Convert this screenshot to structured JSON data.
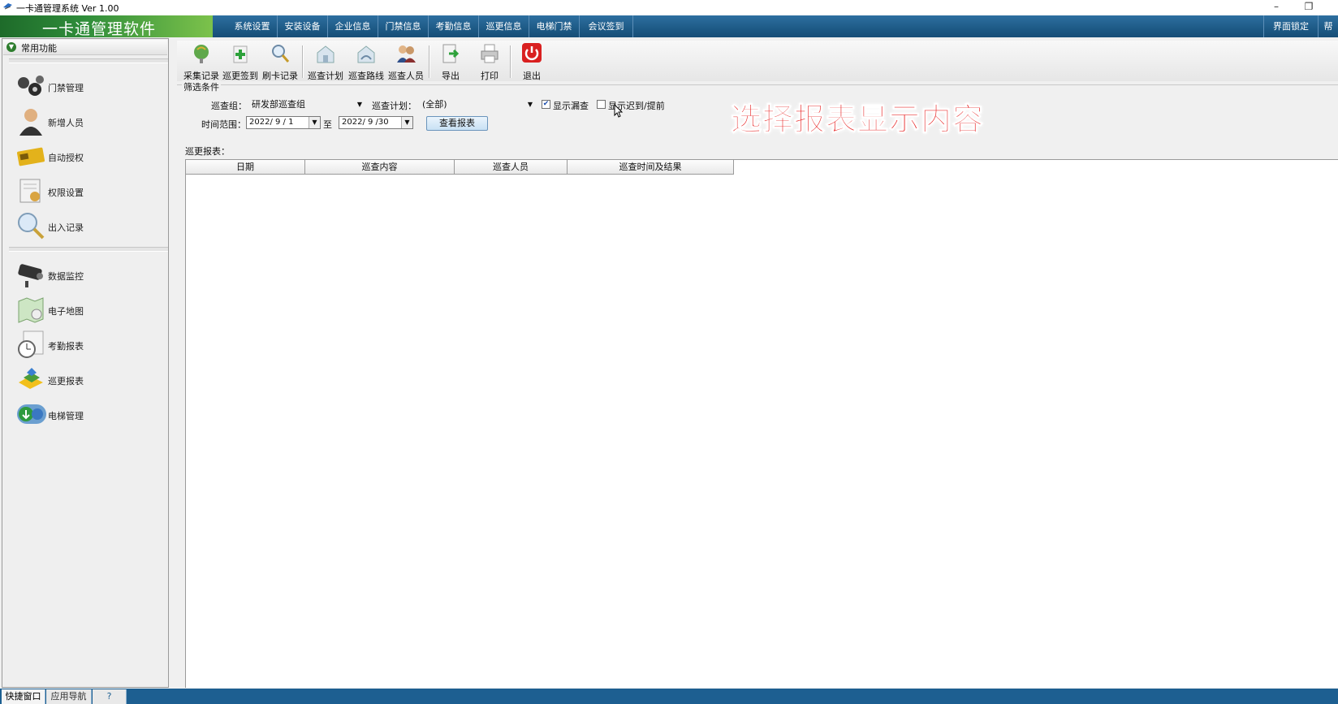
{
  "window": {
    "title": "一卡通管理系统  Ver 1.00",
    "minimize": "–",
    "restore": "❐"
  },
  "brand": {
    "name": "一卡通管理软件"
  },
  "menu": {
    "items": [
      "系统设置",
      "安装设备",
      "企业信息",
      "门禁信息",
      "考勤信息",
      "巡更信息",
      "电梯门禁",
      "会议签到"
    ],
    "right_items": [
      "界面锁定",
      "帮"
    ]
  },
  "sidebar": {
    "header": "常用功能",
    "group1": [
      {
        "label": "门禁管理",
        "icon": "door-access-icon"
      },
      {
        "label": "新增人员",
        "icon": "person-icon"
      },
      {
        "label": "自动授权",
        "icon": "card-icon"
      },
      {
        "label": "权限设置",
        "icon": "permission-icon"
      },
      {
        "label": "出入记录",
        "icon": "magnifier-icon"
      }
    ],
    "group2": [
      {
        "label": "数据监控",
        "icon": "camera-icon"
      },
      {
        "label": "电子地图",
        "icon": "map-icon"
      },
      {
        "label": "考勤报表",
        "icon": "clock-icon"
      },
      {
        "label": "巡更报表",
        "icon": "patrol-icon"
      },
      {
        "label": "电梯管理",
        "icon": "elevator-icon"
      }
    ]
  },
  "bottom_tabs": [
    "快捷窗口",
    "应用导航",
    "?"
  ],
  "toolbar": {
    "buttons": [
      {
        "label": "采集记录",
        "icon": "collect-icon"
      },
      {
        "label": "巡更签到",
        "icon": "add-signin-icon"
      },
      {
        "label": "刷卡记录",
        "icon": "search-record-icon"
      },
      {
        "label": "巡查计划",
        "icon": "plan-icon"
      },
      {
        "label": "巡查路线",
        "icon": "route-icon"
      },
      {
        "label": "巡查人员",
        "icon": "people-icon"
      },
      {
        "label": "导出",
        "icon": "export-icon"
      },
      {
        "label": "打印",
        "icon": "print-icon"
      },
      {
        "label": "退出",
        "icon": "power-icon"
      }
    ]
  },
  "filter": {
    "legend": "筛选条件",
    "group_label": "巡查组：",
    "group_value": "研发部巡查组",
    "plan_label": "巡查计划：",
    "plan_value": "(全部)",
    "show_missed_label": "显示漏查",
    "show_missed_checked": true,
    "show_late_label": "显示迟到/提前",
    "show_late_checked": false,
    "range_label": "时间范围：",
    "date_from": "2022/ 9 / 1",
    "to_label": "至",
    "date_to": "2022/ 9 /30",
    "view_button": "查看报表"
  },
  "annotation": "选择报表显示内容",
  "report": {
    "label": "巡更报表：",
    "columns": [
      "日期",
      "巡查内容",
      "巡查人员",
      "巡查时间及结果"
    ],
    "rows": []
  },
  "colors": {
    "menubar": "#1d5a86",
    "brand": "#2f8d3a",
    "annotation": "#e61d1d",
    "status": "#1d5f91"
  }
}
